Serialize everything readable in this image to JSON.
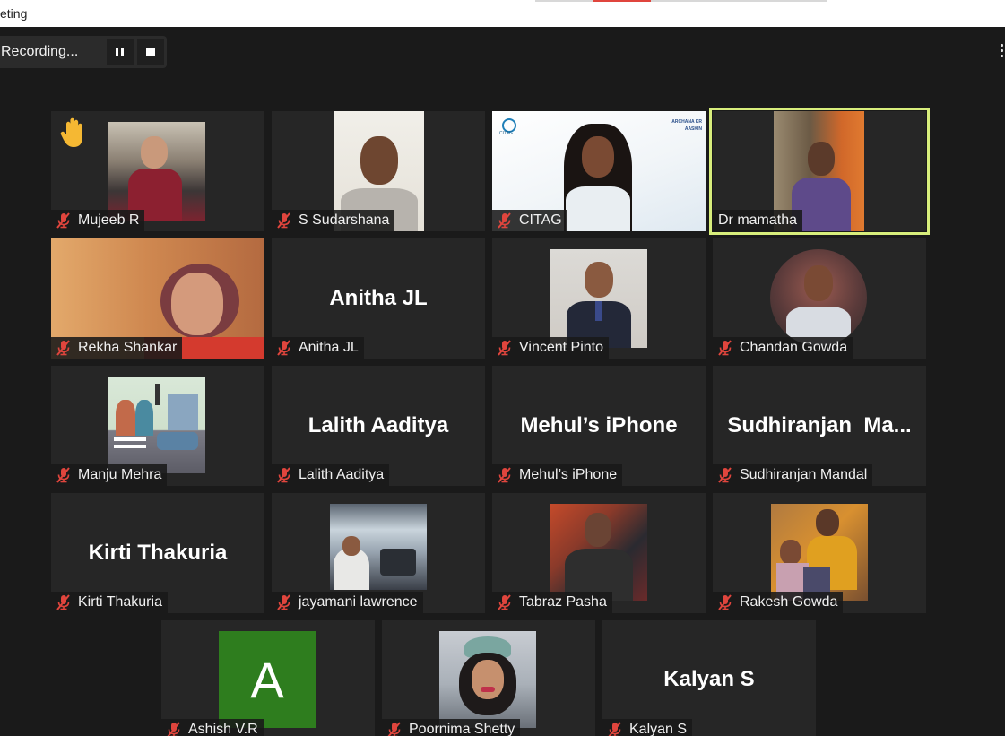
{
  "window": {
    "title": "eting"
  },
  "recording": {
    "label": "Recording..."
  },
  "colors": {
    "background": "#1a1a1a",
    "tile": "#262626",
    "active_speaker_border": "#d8ee7c",
    "muted_mic": "#e0453d",
    "avatar_green": "#2e7d1e"
  },
  "participants": [
    {
      "name": "Mujeeb R",
      "muted": true,
      "hand_raised": true,
      "video": true
    },
    {
      "name": "S Sudarshana",
      "muted": true,
      "video": true
    },
    {
      "name": "CITAG",
      "muted": true,
      "video": true,
      "logo_text": "CITAG",
      "banner_text": "ARCHANA KR\nAASKIN"
    },
    {
      "name": "Dr mamatha",
      "muted": false,
      "active_speaker": true,
      "video": true
    },
    {
      "name": "Rekha Shankar",
      "muted": true,
      "video": true
    },
    {
      "name": "Anitha JL",
      "muted": true,
      "video": false,
      "display": "Anitha JL"
    },
    {
      "name": "Vincent Pinto",
      "muted": true,
      "video": true
    },
    {
      "name": "Chandan Gowda",
      "muted": true,
      "video": true
    },
    {
      "name": "Manju Mehra",
      "muted": true,
      "video": true
    },
    {
      "name": "Lalith Aaditya",
      "muted": true,
      "video": false,
      "display": "Lalith Aaditya"
    },
    {
      "name": "Mehul’s iPhone",
      "muted": true,
      "video": false,
      "display": "Mehul’s iPhone"
    },
    {
      "name": "Sudhiranjan Mandal",
      "muted": true,
      "video": false,
      "display": "Sudhiranjan  Ma..."
    },
    {
      "name": "Kirti Thakuria",
      "muted": true,
      "video": false,
      "display": "Kirti Thakuria"
    },
    {
      "name": "jayamani lawrence",
      "muted": true,
      "video": true
    },
    {
      "name": "Tabraz Pasha",
      "muted": true,
      "video": true
    },
    {
      "name": "Rakesh Gowda",
      "muted": true,
      "video": true
    },
    {
      "name": "Ashish V.R",
      "muted": true,
      "video": false,
      "avatar_letter": "A"
    },
    {
      "name": "Poornima Shetty",
      "muted": true,
      "video": true
    },
    {
      "name": "Kalyan S",
      "muted": true,
      "video": false,
      "display": "Kalyan S"
    }
  ],
  "icons": {
    "muted": "muted-microphone-icon",
    "hand": "raised-hand-icon",
    "pause": "pause-icon",
    "stop": "stop-icon",
    "more": "more-options-icon"
  }
}
